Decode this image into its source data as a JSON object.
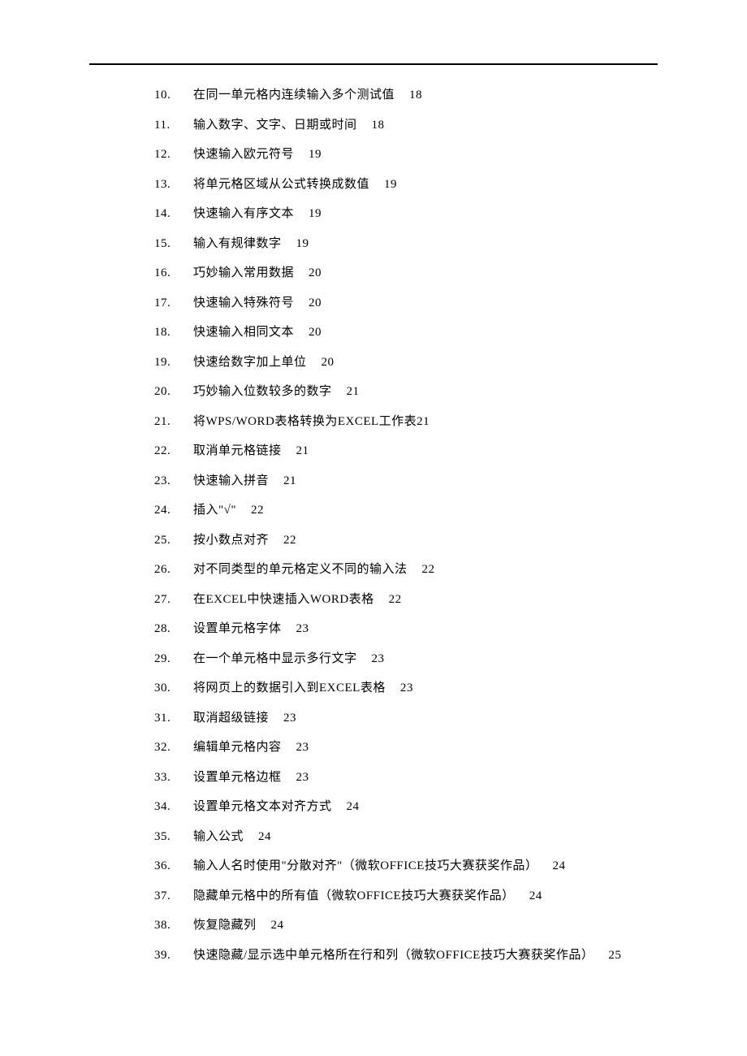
{
  "toc": [
    {
      "num": "10.",
      "title": "在同一单元格内连续输入多个测试值",
      "page": "18"
    },
    {
      "num": "11.",
      "title": "输入数字、文字、日期或时间",
      "page": "18"
    },
    {
      "num": "12.",
      "title": "快速输入欧元符号",
      "page": "19"
    },
    {
      "num": "13.",
      "title": "将单元格区域从公式转换成数值",
      "page": "19"
    },
    {
      "num": "14.",
      "title": "快速输入有序文本",
      "page": "19"
    },
    {
      "num": "15.",
      "title": "输入有规律数字",
      "page": "19"
    },
    {
      "num": "16.",
      "title": "巧妙输入常用数据",
      "page": "20"
    },
    {
      "num": "17.",
      "title": "快速输入特殊符号",
      "page": "20"
    },
    {
      "num": "18.",
      "title": "快速输入相同文本",
      "page": "20"
    },
    {
      "num": "19.",
      "title": "快速给数字加上单位",
      "page": "20"
    },
    {
      "num": "20.",
      "title": "巧妙输入位数较多的数字",
      "page": "21"
    },
    {
      "num": "21.",
      "title": "将WPS/WORD表格转换为EXCEL工作表21",
      "page": ""
    },
    {
      "num": "22.",
      "title": "取消单元格链接",
      "page": "21"
    },
    {
      "num": "23.",
      "title": "快速输入拼音",
      "page": "21"
    },
    {
      "num": "24.",
      "title": "插入\"√\"",
      "page": "22"
    },
    {
      "num": "25.",
      "title": "按小数点对齐",
      "page": "22"
    },
    {
      "num": "26.",
      "title": "对不同类型的单元格定义不同的输入法",
      "page": "22"
    },
    {
      "num": "27.",
      "title": "在EXCEL中快速插入WORD表格",
      "page": "22"
    },
    {
      "num": "28.",
      "title": "设置单元格字体",
      "page": "23"
    },
    {
      "num": "29.",
      "title": "在一个单元格中显示多行文字",
      "page": "23"
    },
    {
      "num": "30.",
      "title": "将网页上的数据引入到EXCEL表格",
      "page": "23"
    },
    {
      "num": "31.",
      "title": "取消超级链接",
      "page": "23"
    },
    {
      "num": "32.",
      "title": "编辑单元格内容",
      "page": "23"
    },
    {
      "num": "33.",
      "title": "设置单元格边框",
      "page": "23"
    },
    {
      "num": "34.",
      "title": "设置单元格文本对齐方式",
      "page": "24"
    },
    {
      "num": "35.",
      "title": "输入公式",
      "page": "24"
    },
    {
      "num": "36.",
      "title": "输入人名时使用\"分散对齐\"（微软OFFICE技巧大赛获奖作品）",
      "page": "24"
    },
    {
      "num": "37.",
      "title": "隐藏单元格中的所有值（微软OFFICE技巧大赛获奖作品）",
      "page": "24"
    },
    {
      "num": "38.",
      "title": "恢复隐藏列",
      "page": "24"
    },
    {
      "num": "39.",
      "title": "快速隐藏/显示选中单元格所在行和列（微软OFFICE技巧大赛获奖作品）",
      "page": "25"
    }
  ]
}
